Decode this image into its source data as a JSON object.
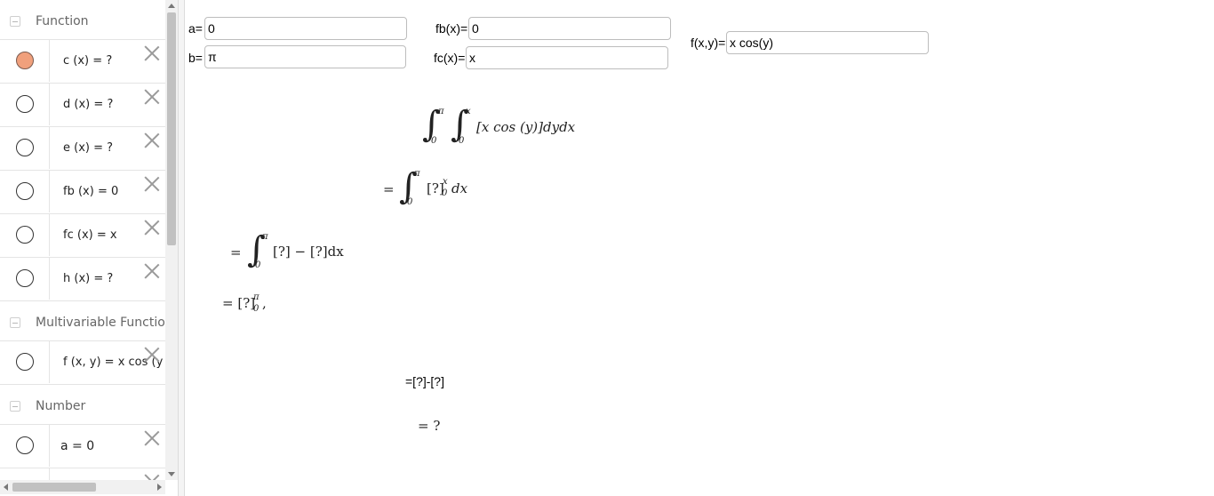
{
  "sidebar": {
    "groups": [
      {
        "label": "Function"
      },
      {
        "label": "Multivariable Function"
      },
      {
        "label": "Number"
      }
    ],
    "functions": [
      {
        "name": "c",
        "args": "(x)",
        "value": "?",
        "visible": true
      },
      {
        "name": "d",
        "args": "(x)",
        "value": "?",
        "visible": false
      },
      {
        "name": "e",
        "args": "(x)",
        "value": "?",
        "visible": false
      },
      {
        "name": "fb",
        "args": "(x)",
        "value": "0",
        "visible": false
      },
      {
        "name": "fc",
        "args": "(x)",
        "value": "x",
        "visible": false
      },
      {
        "name": "h",
        "args": "(x)",
        "value": "?",
        "visible": false
      }
    ],
    "multivariable": [
      {
        "name": "f",
        "args": "(x, y)",
        "value": "x  cos (y",
        "visible": false
      }
    ],
    "numbers": [
      {
        "name": "a",
        "value": "0",
        "visible": false
      }
    ],
    "eq": "="
  },
  "inputs": {
    "a": {
      "label": "a=",
      "value": "0"
    },
    "b": {
      "label": "b=",
      "value": "π"
    },
    "fb": {
      "label": "fb(x)=",
      "value": "0"
    },
    "fc": {
      "label": "fc(x)=",
      "value": "x"
    },
    "f": {
      "label": "f(x,y)=",
      "value": "x cos(y)"
    }
  },
  "math": {
    "integral_sign": "∫",
    "lower_0": "0",
    "upper_pi": "π",
    "upper_x": "x",
    "line1_integrand": "[x  cos (y)]dydx",
    "line2_eq": "=",
    "line2_body": "[?]",
    "line2_dx": "dx",
    "line3_eq": "=",
    "line3_body": "[?] − [?]dx",
    "line4": "= [?]",
    "line4_comma": ",",
    "line5": "=[?]-[?]",
    "line6": "= ?"
  }
}
